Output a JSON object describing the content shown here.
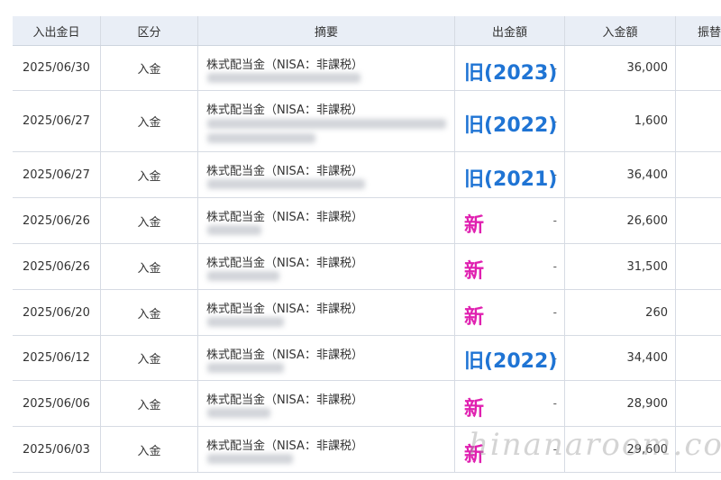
{
  "columns": {
    "date": "入出金日",
    "type": "区分",
    "summary": "摘要",
    "withdrawal": "出金額",
    "deposit": "入金額",
    "transfer": "振替"
  },
  "rows": [
    {
      "date": "2025/06/30",
      "type": "入金",
      "summary": "株式配当金（NISA：非課税）",
      "tag": "旧(2023)",
      "tag_kind": "old",
      "withdrawal": "-",
      "deposit": "36,000"
    },
    {
      "date": "2025/06/27",
      "type": "入金",
      "summary": "株式配当金（NISA：非課税）",
      "tag": "旧(2022)",
      "tag_kind": "old",
      "withdrawal": "-",
      "deposit": "1,600"
    },
    {
      "date": "2025/06/27",
      "type": "入金",
      "summary": "株式配当金（NISA：非課税）",
      "tag": "旧(2021)",
      "tag_kind": "old",
      "withdrawal": "-",
      "deposit": "36,400"
    },
    {
      "date": "2025/06/26",
      "type": "入金",
      "summary": "株式配当金（NISA：非課税）",
      "tag": "新",
      "tag_kind": "new",
      "withdrawal": "-",
      "deposit": "26,600"
    },
    {
      "date": "2025/06/26",
      "type": "入金",
      "summary": "株式配当金（NISA：非課税）",
      "tag": "新",
      "tag_kind": "new",
      "withdrawal": "-",
      "deposit": "31,500"
    },
    {
      "date": "2025/06/20",
      "type": "入金",
      "summary": "株式配当金（NISA：非課税）",
      "tag": "新",
      "tag_kind": "new",
      "withdrawal": "-",
      "deposit": "260"
    },
    {
      "date": "2025/06/12",
      "type": "入金",
      "summary": "株式配当金（NISA：非課税）",
      "tag": "旧(2022)",
      "tag_kind": "old",
      "withdrawal": "-",
      "deposit": "34,400"
    },
    {
      "date": "2025/06/06",
      "type": "入金",
      "summary": "株式配当金（NISA：非課税）",
      "tag": "新",
      "tag_kind": "new",
      "withdrawal": "-",
      "deposit": "28,900"
    },
    {
      "date": "2025/06/03",
      "type": "入金",
      "summary": "株式配当金（NISA：非課税）",
      "tag": "新",
      "tag_kind": "new",
      "withdrawal": "-",
      "deposit": "29,600"
    }
  ],
  "watermark": "hinanaroom.com",
  "colors": {
    "old_tag": "#1f74d4",
    "new_tag": "#e020b0",
    "header_bg": "#e9eef6"
  }
}
